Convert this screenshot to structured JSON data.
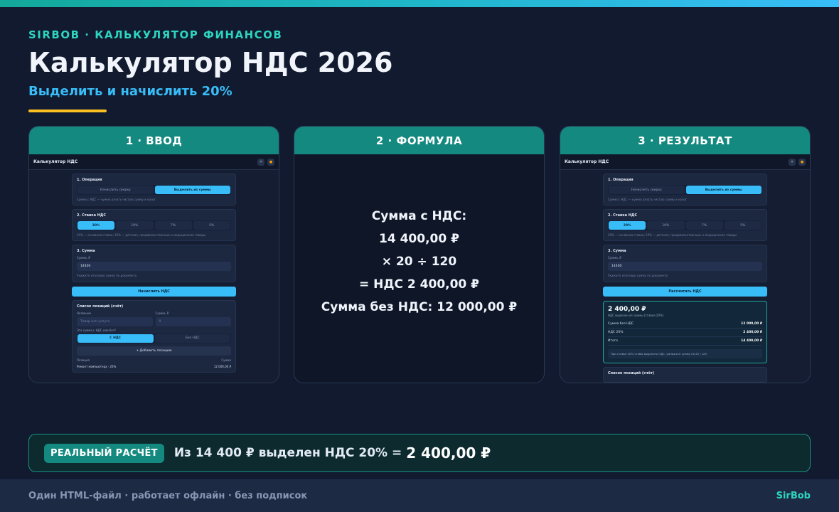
{
  "header": {
    "eyebrow": "SIRBOB · КАЛЬКУЛЯТОР ФИНАНСОВ",
    "title": "Калькулятор НДС 2026",
    "subtitle": "Выделить и начислить 20%"
  },
  "steps": [
    {
      "label": "1 · ВВОД"
    },
    {
      "label": "2 · ФОРМУЛА"
    },
    {
      "label": "3 · РЕЗУЛЬТАТ"
    }
  ],
  "mini_app": {
    "title": "Калькулятор НДС",
    "op_heading": "1. Операция",
    "op_options": [
      "Начислить сверху",
      "Выделить из суммы"
    ],
    "op_note": "Сумма с НДС — нужно узнать чистую сумму и налог",
    "rate_heading": "2. Ставка НДС",
    "rates": [
      "20%",
      "10%",
      "7%",
      "5%"
    ],
    "rate_note": "20% — основная ставка; 10% — детские, продовольственные и медицинские товары",
    "sum_heading": "3. Сумма",
    "sum_label": "Сумма, ₽",
    "sum_value": "14400",
    "sum_note": "Укажите итоговую сумму по документу",
    "input_cta": "Начислить НДС",
    "result_cta": "Рассчитать НДС",
    "list_heading": "Список позиций (счёт)",
    "name_label": "Название",
    "name_placeholder": "Товар или услуга",
    "amount_label": "Сумма, ₽",
    "amount_placeholder": "0",
    "incl_label": "Эта сумма с НДС или без?",
    "incl_options": [
      "С НДС",
      "Без НДС"
    ],
    "add_item": "+ Добавить позицию",
    "col_item": "Позиция",
    "col_sum": "Сумма",
    "item_name": "Ремонт компьютера · 20%",
    "item_value": "12 000,00 ₽",
    "result": {
      "big": "2 400,00 ₽",
      "sub": "НДС выделен из суммы (ставка 20%)",
      "lines": [
        {
          "k": "Сумма без НДС",
          "v": "12 000,00 ₽"
        },
        {
          "k": "НДС 20%",
          "v": "2 400,00 ₽"
        },
        {
          "k": "Итого",
          "v": "14 400,00 ₽"
        }
      ],
      "tip": "При ставке 20% чтобы выделить НДС, умножьте сумму на 20 / 120"
    },
    "icons": [
      "sun-icon",
      "palette-icon"
    ]
  },
  "formula": [
    "Сумма с НДС:",
    "14 400,00 ₽",
    "× 20 ÷ 120",
    "= НДС 2 400,00 ₽",
    "Сумма без НДС: 12 000,00 ₽"
  ],
  "banner": {
    "badge": "РЕАЛЬНЫЙ РАСЧЁТ",
    "text": "Из 14 400 ₽ выделен НДС 20% =",
    "value": "2 400,00 ₽"
  },
  "footer": {
    "text": "Один HTML-файл · работает офлайн · без подписок",
    "brand": "SirBob"
  },
  "colors": {
    "background": "#111a2e",
    "accent_teal": "#14897f",
    "accent_blue": "#38bdf8",
    "accent_yellow": "#fbbf24"
  }
}
